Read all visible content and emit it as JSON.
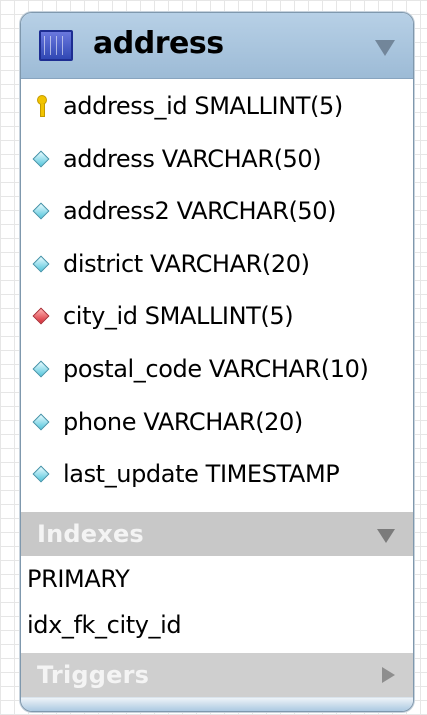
{
  "table": {
    "name": "address",
    "columns": [
      {
        "label": "address_id SMALLINT(5)",
        "icon": "primary-key-icon"
      },
      {
        "label": "address VARCHAR(50)",
        "icon": "column-diamond-icon"
      },
      {
        "label": "address2 VARCHAR(50)",
        "icon": "column-diamond-icon"
      },
      {
        "label": "district VARCHAR(20)",
        "icon": "column-diamond-icon"
      },
      {
        "label": "city_id SMALLINT(5)",
        "icon": "foreign-key-diamond-icon"
      },
      {
        "label": "postal_code VARCHAR(10)",
        "icon": "column-diamond-icon"
      },
      {
        "label": "phone VARCHAR(20)",
        "icon": "column-diamond-icon"
      },
      {
        "label": "last_update TIMESTAMP",
        "icon": "column-diamond-icon"
      }
    ]
  },
  "indexes": {
    "title": "Indexes",
    "items": [
      "PRIMARY",
      "idx_fk_city_id"
    ]
  },
  "triggers": {
    "title": "Triggers"
  },
  "colors": {
    "header_blue": "#9dbbd6",
    "section_gray": "#c8c8c8",
    "foreign_key_red": "#d52b35",
    "column_cyan": "#55c6dc",
    "primary_key_yellow": "#f2c400"
  }
}
